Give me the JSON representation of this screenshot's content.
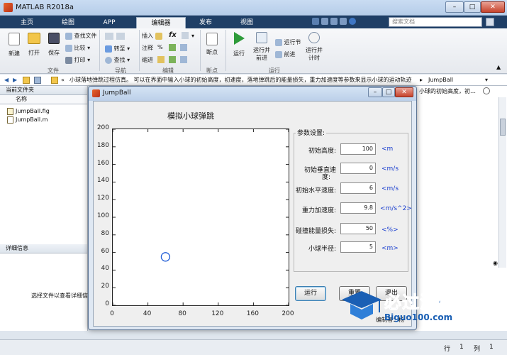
{
  "app": {
    "title": "MATLAB R2018a",
    "search_placeholder": "搜索文档"
  },
  "tabs": [
    "主页",
    "绘图",
    "APP",
    "编辑器",
    "发布",
    "视图"
  ],
  "ribbon": {
    "file": {
      "new": "新建",
      "open": "打开",
      "save": "保存",
      "find_files": "查找文件",
      "compare": "比较",
      "print": "打印",
      "group": "文件"
    },
    "navigate": {
      "goto": "转至",
      "find": "查找",
      "group": "导航"
    },
    "edit": {
      "insert": "插入",
      "fx": "fx",
      "comment": "注释",
      "indent": "缩进",
      "percent": "%",
      "group": "编辑"
    },
    "breakpoints": {
      "label": "断点",
      "group": "断点"
    },
    "run": {
      "run": "运行",
      "run_advance_1": "运行并",
      "run_advance_2": "前进",
      "run_section": "运行节",
      "advance": "前进",
      "run_time_1": "运行并",
      "run_time_2": "计时",
      "group": "运行"
    }
  },
  "address": {
    "text": "小球落地弹跳过程仿真。 可以在界面中输入小球的初始高度，初速度，落地弹跳后的能量损失，重力加速度等参数来显示小球的运动轨迹",
    "crumb": "JumpBall"
  },
  "left_panel": {
    "title": "当前文件夹",
    "col_name": "名称",
    "files": [
      "JumpBall.fig",
      "JumpBall.m"
    ],
    "details_title": "详细信息",
    "details_msg": "选择文件以查看详细信"
  },
  "right_bg": {
    "text": "小球的初始高度，初…"
  },
  "statusbar": {
    "row_label": "行",
    "row": "1",
    "col_label": "列",
    "col": "1"
  },
  "dialog": {
    "title": "JumpBall",
    "plot_title": "模拟小球弹跳",
    "params_title": "参数设置:",
    "params": [
      {
        "label": "初始高度:",
        "value": "100",
        "unit": "<m"
      },
      {
        "label1": "初始垂直速",
        "label2": "度:",
        "value": "0",
        "unit": "<m/s"
      },
      {
        "label": "初始水平速度:",
        "value": "6",
        "unit": "<m/s"
      },
      {
        "label": "重力加速度:",
        "value": "9.8",
        "unit": "<m/s^2>"
      },
      {
        "label": "碰撞能量损失:",
        "value": "50",
        "unit": "<%>"
      },
      {
        "label": "小球半径:",
        "value": "5",
        "unit": "<m>"
      }
    ],
    "run_btn": "运行",
    "replay_btn": "重置",
    "exit_btn": "退出",
    "footer": "编制者：杨"
  },
  "chart_data": {
    "type": "scatter",
    "title": "模拟小球弹跳",
    "xlim": [
      0,
      200
    ],
    "ylim": [
      0,
      200
    ],
    "xticks": [
      0,
      40,
      80,
      120,
      160,
      200
    ],
    "yticks": [
      0,
      20,
      40,
      60,
      80,
      100,
      120,
      140,
      160,
      180,
      200
    ],
    "points": [
      {
        "x": 60,
        "y": 55,
        "marker": "circle"
      }
    ],
    "grid": false
  },
  "watermark": {
    "text1": "必过源码",
    "text2": "Biguo100.com"
  },
  "colors": {
    "tabbar": "#1f3f66",
    "unit_blue": "#1a3fcf",
    "ball": "#1e5bd6"
  }
}
